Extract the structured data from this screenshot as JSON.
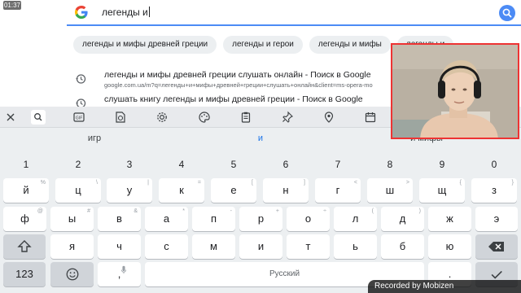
{
  "status": {
    "time": "01:37"
  },
  "search": {
    "query": "легенды и"
  },
  "chips": [
    "легенды и мифы древней греции",
    "легенды и герои",
    "легенды и мифы",
    "легенды и"
  ],
  "suggestions": [
    {
      "title": "легенды и мифы древней греции слушать онлайн - Поиск в Google",
      "url": "google.com.ua/m?q=легенды+и+мифы+древней+греции+слушать+онлайн&client=ms-opera-mo"
    },
    {
      "title": "слушать книгу легенды и мифы древней греции - Поиск в Google",
      "url": ""
    }
  ],
  "keyboard": {
    "toolbar_icons": [
      "close-icon",
      "search-icon",
      "gif-icon",
      "sticker-icon",
      "settings-icon",
      "palette-icon",
      "clipboard-icon",
      "pin-icon",
      "location-icon",
      "calendar-icon"
    ],
    "predictions": [
      "игр",
      "и",
      "и мифы"
    ],
    "number_row": [
      "1",
      "2",
      "3",
      "4",
      "5",
      "6",
      "7",
      "8",
      "9",
      "0"
    ],
    "row1": [
      {
        "k": "й",
        "h": "%"
      },
      {
        "k": "ц",
        "h": "\\"
      },
      {
        "k": "у",
        "h": "|"
      },
      {
        "k": "к",
        "h": "="
      },
      {
        "k": "е",
        "h": "["
      },
      {
        "k": "н",
        "h": "]"
      },
      {
        "k": "г",
        "h": "<"
      },
      {
        "k": "ш",
        "h": ">"
      },
      {
        "k": "щ",
        "h": "{"
      },
      {
        "k": "з",
        "h": "}"
      }
    ],
    "row2": [
      {
        "k": "ф",
        "h": "@"
      },
      {
        "k": "ы",
        "h": "#"
      },
      {
        "k": "в",
        "h": "&"
      },
      {
        "k": "а",
        "h": "*"
      },
      {
        "k": "п",
        "h": "-"
      },
      {
        "k": "р",
        "h": "+"
      },
      {
        "k": "о",
        "h": "÷"
      },
      {
        "k": "л",
        "h": "("
      },
      {
        "k": "д",
        "h": ")"
      },
      {
        "k": "ж",
        "h": ""
      },
      {
        "k": "э",
        "h": ""
      }
    ],
    "row3": [
      {
        "k": "я",
        "h": ""
      },
      {
        "k": "ч",
        "h": ""
      },
      {
        "k": "с",
        "h": ""
      },
      {
        "k": "м",
        "h": ""
      },
      {
        "k": "и",
        "h": ""
      },
      {
        "k": "т",
        "h": ""
      },
      {
        "k": "ь",
        "h": ""
      },
      {
        "k": "б",
        "h": ""
      },
      {
        "k": "ю",
        "h": ""
      }
    ],
    "numbers_label": "123",
    "space_label": "Русский",
    "comma": ",",
    "period": "."
  },
  "watermark": {
    "text": "Recorded by Mobizen"
  }
}
